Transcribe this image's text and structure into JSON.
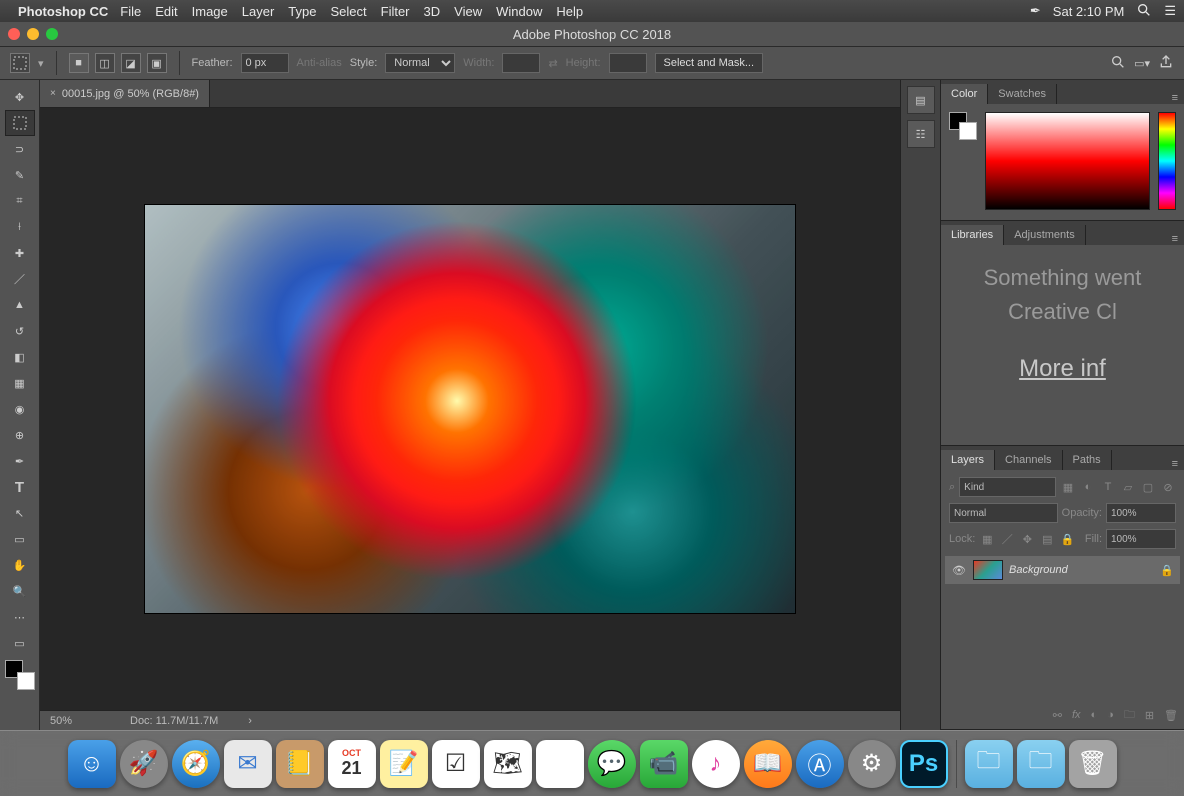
{
  "menubar": {
    "app_name": "Photoshop CC",
    "items": [
      "File",
      "Edit",
      "Image",
      "Layer",
      "Type",
      "Select",
      "Filter",
      "3D",
      "View",
      "Window",
      "Help"
    ],
    "datetime": "Sat 2:10 PM"
  },
  "titlebar": {
    "title": "Adobe Photoshop CC 2018"
  },
  "optionbar": {
    "feather_label": "Feather:",
    "feather_value": "0 px",
    "antialias": "Anti-alias",
    "style_label": "Style:",
    "style_value": "Normal",
    "width_label": "Width:",
    "height_label": "Height:",
    "select_mask": "Select and Mask..."
  },
  "document": {
    "tab_title": "00015.jpg @ 50% (RGB/8#)",
    "zoom": "50%",
    "doc_size": "Doc: 11.7M/11.7M"
  },
  "panels": {
    "color": {
      "tab_color": "Color",
      "tab_swatches": "Swatches"
    },
    "libraries": {
      "tab_libraries": "Libraries",
      "tab_adjustments": "Adjustments",
      "error_line1": "Something went",
      "error_line2": "Creative Cl",
      "more_info": "More inf"
    },
    "layers": {
      "tab_layers": "Layers",
      "tab_channels": "Channels",
      "tab_paths": "Paths",
      "kind": "Kind",
      "blend": "Normal",
      "opacity_label": "Opacity:",
      "opacity_value": "100%",
      "lock_label": "Lock:",
      "fill_label": "Fill:",
      "fill_value": "100%",
      "layer_name": "Background"
    }
  },
  "dock": {
    "calendar_month": "OCT",
    "calendar_day": "21",
    "ps_label": "Ps"
  }
}
